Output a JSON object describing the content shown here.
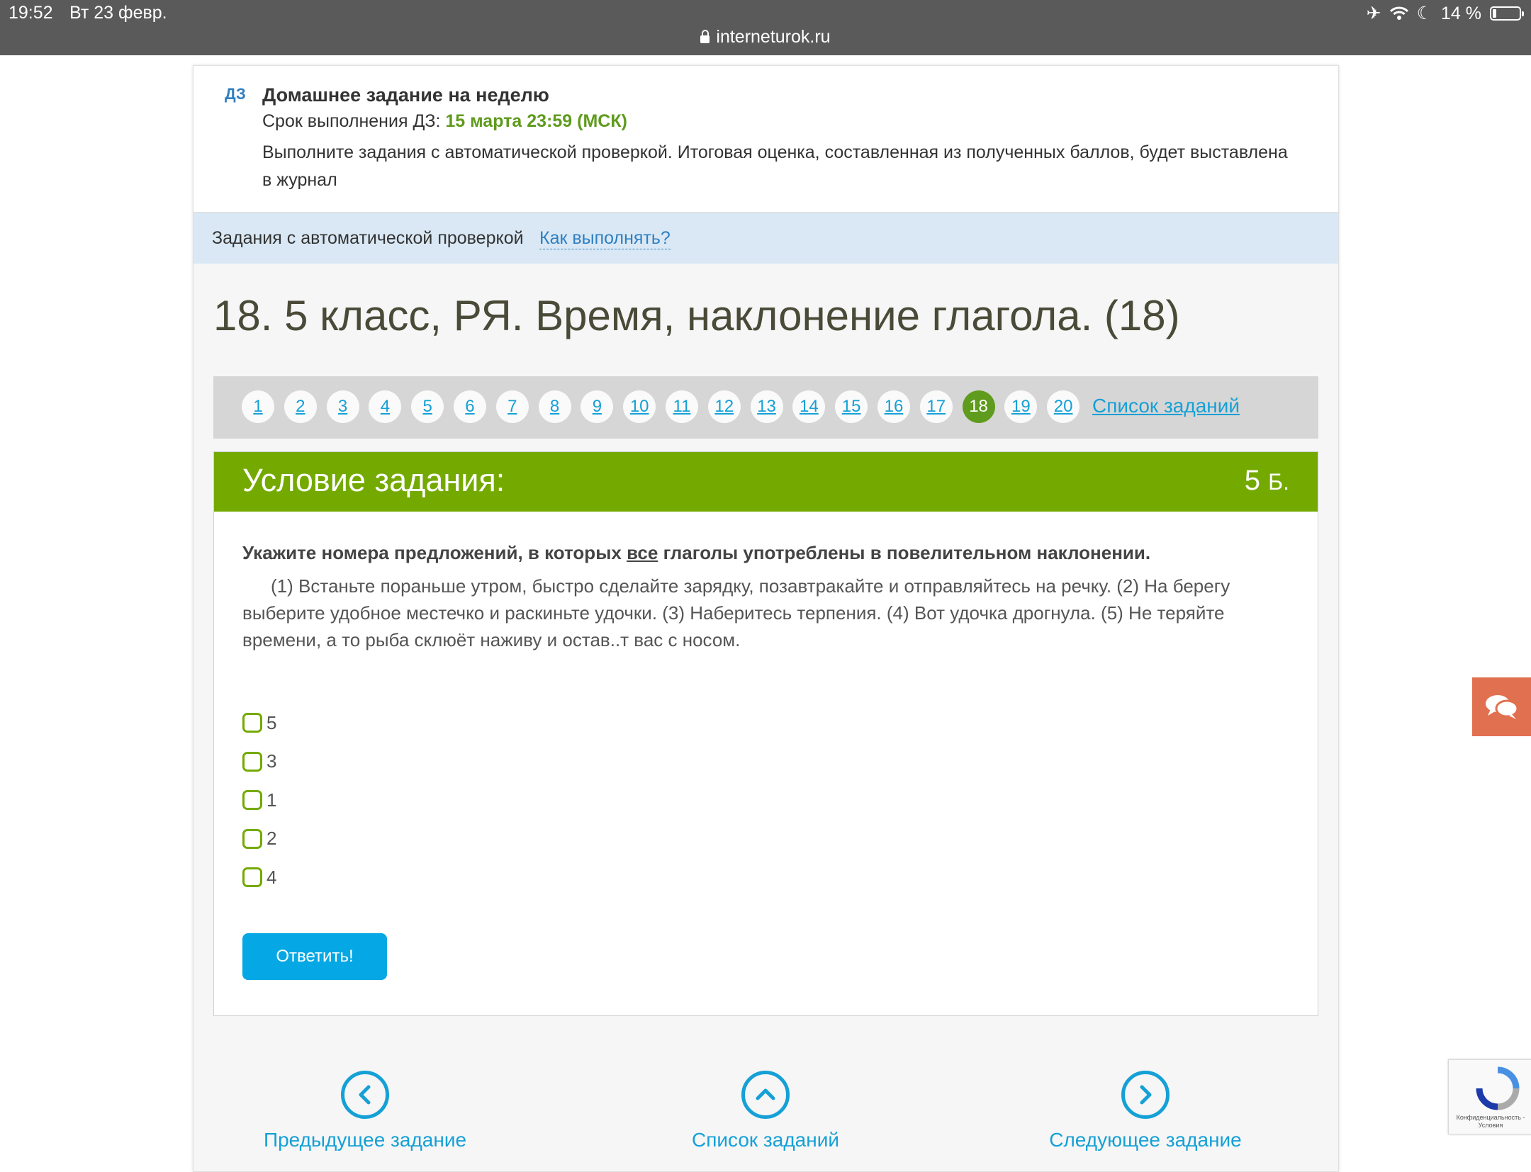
{
  "status_bar": {
    "time": "19:52",
    "date": "Вт 23 февр.",
    "url": "interneturok.ru",
    "battery": "14 %",
    "battery_level": 0.14
  },
  "homework": {
    "badge": "ДЗ",
    "title": "Домашнее задание на неделю",
    "deadline_label": "Срок выполнения ДЗ:",
    "deadline_value": "15 марта 23:59 (МСК)",
    "description": "Выполните задания с автоматической проверкой. Итоговая оценка, составленная из полученных баллов, будет выставлена в журнал"
  },
  "auto_bar": {
    "label": "Задания с автоматической проверкой",
    "how_link": "Как выполнять?"
  },
  "task_title": "18. 5 класс, РЯ. Время, наклонение глагола. (18)",
  "task_nav": {
    "numbers": [
      "1",
      "2",
      "3",
      "4",
      "5",
      "6",
      "7",
      "8",
      "9",
      "10",
      "11",
      "12",
      "13",
      "14",
      "15",
      "16",
      "17",
      "18",
      "19",
      "20"
    ],
    "active": "18",
    "list_link": "Список заданий"
  },
  "condition": {
    "header": "Условие задания:",
    "points": "5",
    "points_unit": "Б.",
    "question_before": "Укажите номера предложений, в которых ",
    "question_emph": "все",
    "question_after": " глаголы употреблены в повелительном наклонении.",
    "text": "(1) Встаньте пораньше утром, быстро сделайте зарядку, позавтракайте и отправляйтесь на речку. (2) На берегу выберите удобное местечко и раскиньте удочки. (3) Наберитесь терпения. (4) Вот удочка дрогнула. (5) Не теряйте времени, а то рыба склюёт наживу и остав..т вас с носом.",
    "options": [
      "5",
      "3",
      "1",
      "2",
      "4"
    ],
    "answer_button": "Ответить!"
  },
  "bottom_nav": {
    "prev": "Предыдущее задание",
    "list": "Список заданий",
    "next": "Следующее задание"
  },
  "recaptcha": {
    "text": "Конфиденциальность - Условия"
  },
  "colors": {
    "green": "#74aa00",
    "blue_link": "#15a0d6",
    "chat": "#e17050"
  }
}
